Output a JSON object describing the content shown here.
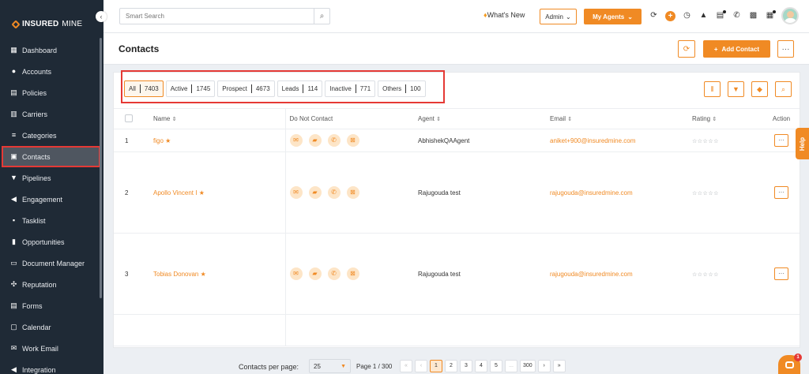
{
  "brand": {
    "insured": "INSURED",
    "mine": "MINE"
  },
  "sidebar": {
    "items": [
      {
        "label": "Dashboard",
        "icon": "dashboard-icon"
      },
      {
        "label": "Accounts",
        "icon": "accounts-icon"
      },
      {
        "label": "Policies",
        "icon": "policies-icon"
      },
      {
        "label": "Carriers",
        "icon": "carriers-icon"
      },
      {
        "label": "Categories",
        "icon": "categories-icon"
      },
      {
        "label": "Contacts",
        "icon": "contacts-icon",
        "active": true
      },
      {
        "label": "Pipelines",
        "icon": "pipelines-icon"
      },
      {
        "label": "Engagement",
        "icon": "megaphone-icon"
      },
      {
        "label": "Tasklist",
        "icon": "tasklist-icon"
      },
      {
        "label": "Opportunities",
        "icon": "opportunities-icon"
      },
      {
        "label": "Document Manager",
        "icon": "folder-icon"
      },
      {
        "label": "Reputation",
        "icon": "reputation-icon"
      },
      {
        "label": "Forms",
        "icon": "forms-icon"
      },
      {
        "label": "Calendar",
        "icon": "calendar-icon"
      },
      {
        "label": "Work Email",
        "icon": "email-icon"
      },
      {
        "label": "Integration",
        "icon": "integration-icon"
      }
    ]
  },
  "topbar": {
    "search_placeholder": "Smart Search",
    "whats_new": "What's New",
    "role": "Admin",
    "my_agents": "My Agents"
  },
  "page": {
    "title": "Contacts",
    "add_contact": "Add Contact"
  },
  "filters": [
    {
      "label": "All",
      "count": "7403",
      "active": true
    },
    {
      "label": "Active",
      "count": "1745"
    },
    {
      "label": "Prospect",
      "count": "4673"
    },
    {
      "label": "Leads",
      "count": "114"
    },
    {
      "label": "Inactive",
      "count": "771"
    },
    {
      "label": "Others",
      "count": "100"
    }
  ],
  "table": {
    "headers": {
      "name": "Name",
      "dnc": "Do Not Contact",
      "agent": "Agent",
      "email": "Email",
      "rating": "Rating",
      "action": "Action"
    },
    "rows": [
      {
        "index": "1",
        "name": "figo",
        "agent": "AbhishekQAAgent",
        "email": "aniket+900@insuredmine.com",
        "rating": "☆☆☆☆☆"
      },
      {
        "index": "2",
        "name": "Apollo Vincent I",
        "agent": "Rajugouda test",
        "email": "rajugouda@insuredmine.com",
        "rating": "☆☆☆☆☆"
      },
      {
        "index": "3",
        "name": "Tobias Donovan",
        "agent": "Rajugouda test",
        "email": "rajugouda@insuredmine.com",
        "rating": "☆☆☆☆☆"
      }
    ]
  },
  "footer": {
    "per_page_label": "Contacts per page:",
    "per_page_value": "25",
    "page_info": "Page 1 / 300",
    "pages": [
      "1",
      "2",
      "3",
      "4",
      "5",
      "...",
      "300"
    ]
  },
  "help": {
    "label": "Help"
  },
  "chat": {
    "badge": "1"
  },
  "colors": {
    "accent": "#f08a24",
    "sidebar": "#1f2a36",
    "highlight": "#e53935"
  }
}
